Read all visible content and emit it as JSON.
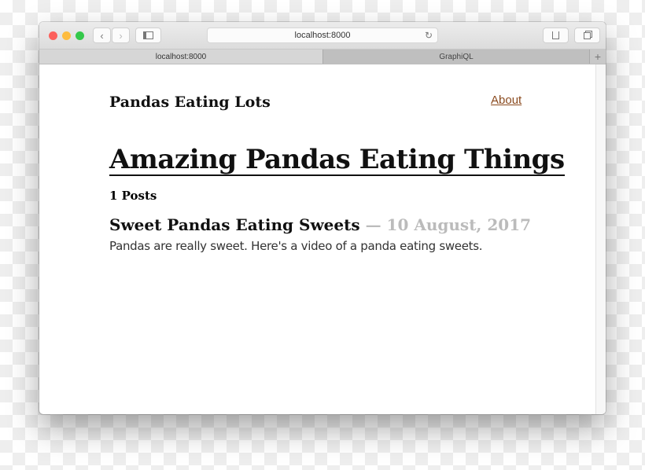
{
  "browser": {
    "url": "localhost:8000",
    "tabs": [
      {
        "label": "localhost:8000",
        "active": true
      },
      {
        "label": "GraphiQL",
        "active": false
      }
    ],
    "new_tab": "+",
    "back": "‹",
    "forward": "›",
    "reload": "↻"
  },
  "site": {
    "title": "Pandas Eating Lots",
    "nav": {
      "about": "About"
    },
    "link_color": "#8a4a1e"
  },
  "page": {
    "heading": "Amazing Pandas Eating Things",
    "post_count": "1 Posts",
    "posts": [
      {
        "title": "Sweet Pandas Eating Sweets",
        "date": "— 10 August, 2017",
        "excerpt": "Pandas are really sweet. Here's a video of a panda eating sweets."
      }
    ]
  }
}
